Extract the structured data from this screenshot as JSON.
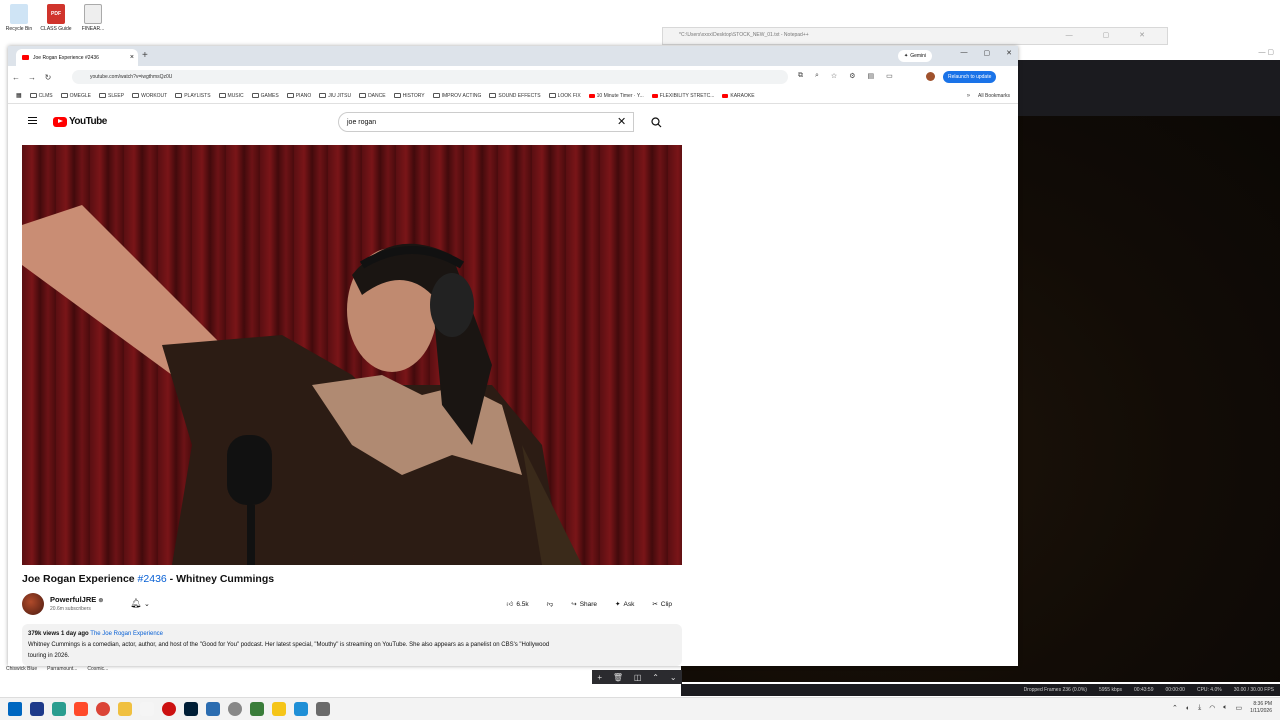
{
  "desktop": {
    "icons": [
      {
        "label": "Recycle Bin",
        "color": "#5aa0d8"
      },
      {
        "label": "CLASS\nGuide",
        "color": "#d0342c"
      },
      {
        "label": "FINEAR...",
        "color": "#f0f0f0"
      }
    ],
    "bottom_labels": [
      "Chiswick\nBlue",
      "Parramount...",
      "Cosmic..."
    ]
  },
  "notepad": {
    "title": "*C:\\Users\\xxxx\\Desktop\\STOCK_NEW_01.txt - Notepad++"
  },
  "chrome": {
    "tab_title": "Joe Rogan Experience #2436",
    "new_tab": "+",
    "gemini_label": "Gemini",
    "url": "youtube.com/watch?v=iwgthmsQz0U",
    "relaunch_label": "Relaunch to update",
    "bookmarks": [
      {
        "label": "CLMS",
        "type": "folder"
      },
      {
        "label": "OMEGLE",
        "type": "folder"
      },
      {
        "label": "SLEEP",
        "type": "folder"
      },
      {
        "label": "WORKOUT",
        "type": "folder"
      },
      {
        "label": "PLAYLISTS",
        "type": "folder"
      },
      {
        "label": "MUSIC",
        "type": "folder"
      },
      {
        "label": "GAMES",
        "type": "folder"
      },
      {
        "label": "PIANO",
        "type": "folder"
      },
      {
        "label": "JIU JITSU",
        "type": "folder"
      },
      {
        "label": "DANCE",
        "type": "folder"
      },
      {
        "label": "HISTORY",
        "type": "folder"
      },
      {
        "label": "IMPROV ACTING",
        "type": "folder"
      },
      {
        "label": "SOUND EFFECTS",
        "type": "folder"
      },
      {
        "label": "LOOK FIX",
        "type": "folder"
      },
      {
        "label": "10 Minute Timer · Y...",
        "type": "yt"
      },
      {
        "label": "FLEXIBILITY STRETC...",
        "type": "yt"
      },
      {
        "label": "KARAOKE",
        "type": "yt"
      }
    ],
    "bookmarks_more": "»",
    "all_bookmarks": "All Bookmarks"
  },
  "youtube": {
    "logo": "YouTube",
    "search_value": "joe rogan",
    "video_title_prefix": "Joe Rogan Experience ",
    "video_title_tag": "#2436",
    "video_title_suffix": " - Whitney Cummings",
    "channel_name": "PowerfulJRE",
    "channel_subs": "20.6m subscribers",
    "likes": "6.5k",
    "share_label": "Share",
    "ask_label": "Ask",
    "clip_label": "Clip",
    "views": "379k views",
    "age": "1 day ago",
    "desc_tag": "The Joe Rogan Experience",
    "description": "Whitney Cummings is a comedian, actor, author, and host of the \"Good for You\" podcast. Her latest special, \"Mouthy\" is streaming on YouTube. She also appears as a panelist on CBS's \"Hollywood",
    "description_line2": "touring in 2026."
  },
  "obs": {
    "status": [
      "Dropped Frames 236 (0.0%)",
      "5955 kbps",
      "00:43:59",
      "00:00:00",
      "CPU: 4.0%",
      "30.00 / 30.00 FPS"
    ]
  },
  "taskbar": {
    "time": "8:36 PM",
    "date": "1/11/2026",
    "icon_colors": [
      "#0067c0",
      "#1e3a8a",
      "#2a9d8f",
      "#ff4a2a",
      "#db4437",
      "#f0c040",
      "#f5f5f5",
      "#cc1111",
      "#001e36",
      "#2b6cb0",
      "#888888",
      "#3a7d3a",
      "#f5c518",
      "#1f8fd6",
      "#6a6a6a"
    ]
  }
}
